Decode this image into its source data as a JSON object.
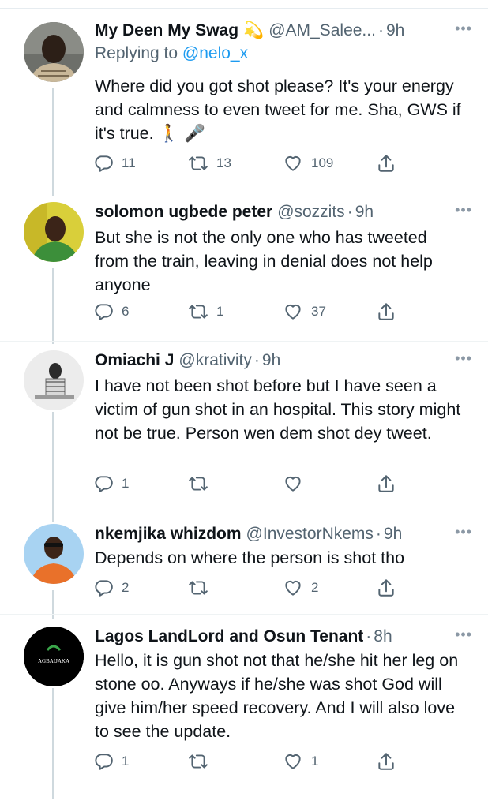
{
  "tweets": [
    {
      "name": "My Deen My Swag",
      "emoji": "💫",
      "handle": "@AM_Salee...",
      "time": "9h",
      "more": "•••",
      "reply_prefix": "Replying to",
      "reply_to": "@nelo_x",
      "text": "Where did you got shot please? It's your energy and calmness to even tweet for me. Sha, GWS if it's true. 🚶 🎤",
      "replies": "11",
      "retweets": "13",
      "likes": "109"
    },
    {
      "name": "solomon ugbede peter",
      "handle": "@sozzits",
      "time": "9h",
      "more": "•••",
      "text": "But she is not the only one who has tweeted from the train, leaving in denial does not help anyone",
      "replies": "6",
      "retweets": "1",
      "likes": "37"
    },
    {
      "name": "Omiachi J",
      "handle": "@krativity",
      "time": "9h",
      "more": "•••",
      "text": "I have not been shot before but I have seen a victim of gun shot in an hospital. This story might not be true. Person wen dem shot dey tweet.",
      "replies": "1",
      "retweets": "",
      "likes": ""
    },
    {
      "name": "nkemjika whizdom",
      "handle": "@InvestorNkems",
      "time": "9h",
      "more": "•••",
      "text": "Depends on where the person is shot tho",
      "replies": "2",
      "retweets": "",
      "likes": "2"
    },
    {
      "name": "Lagos LandLord and Osun Tenant",
      "handle": "",
      "time": "8h",
      "more": "•••",
      "avatar_text": "AGBAIJAKA",
      "text": "Hello, it is gun shot not that he/she hit her leg on stone oo. Anyways if he/she was shot God will give him/her speed recovery. And I will also love to see the update.",
      "replies": "1",
      "retweets": "",
      "likes": "1"
    }
  ],
  "colors": {
    "text": "#0f1419",
    "secondary": "#536471",
    "link": "#1d9bf0",
    "thread": "#cfd9de"
  },
  "icons": [
    "reply-icon",
    "retweet-icon",
    "like-icon",
    "share-icon",
    "more-options-icon"
  ]
}
